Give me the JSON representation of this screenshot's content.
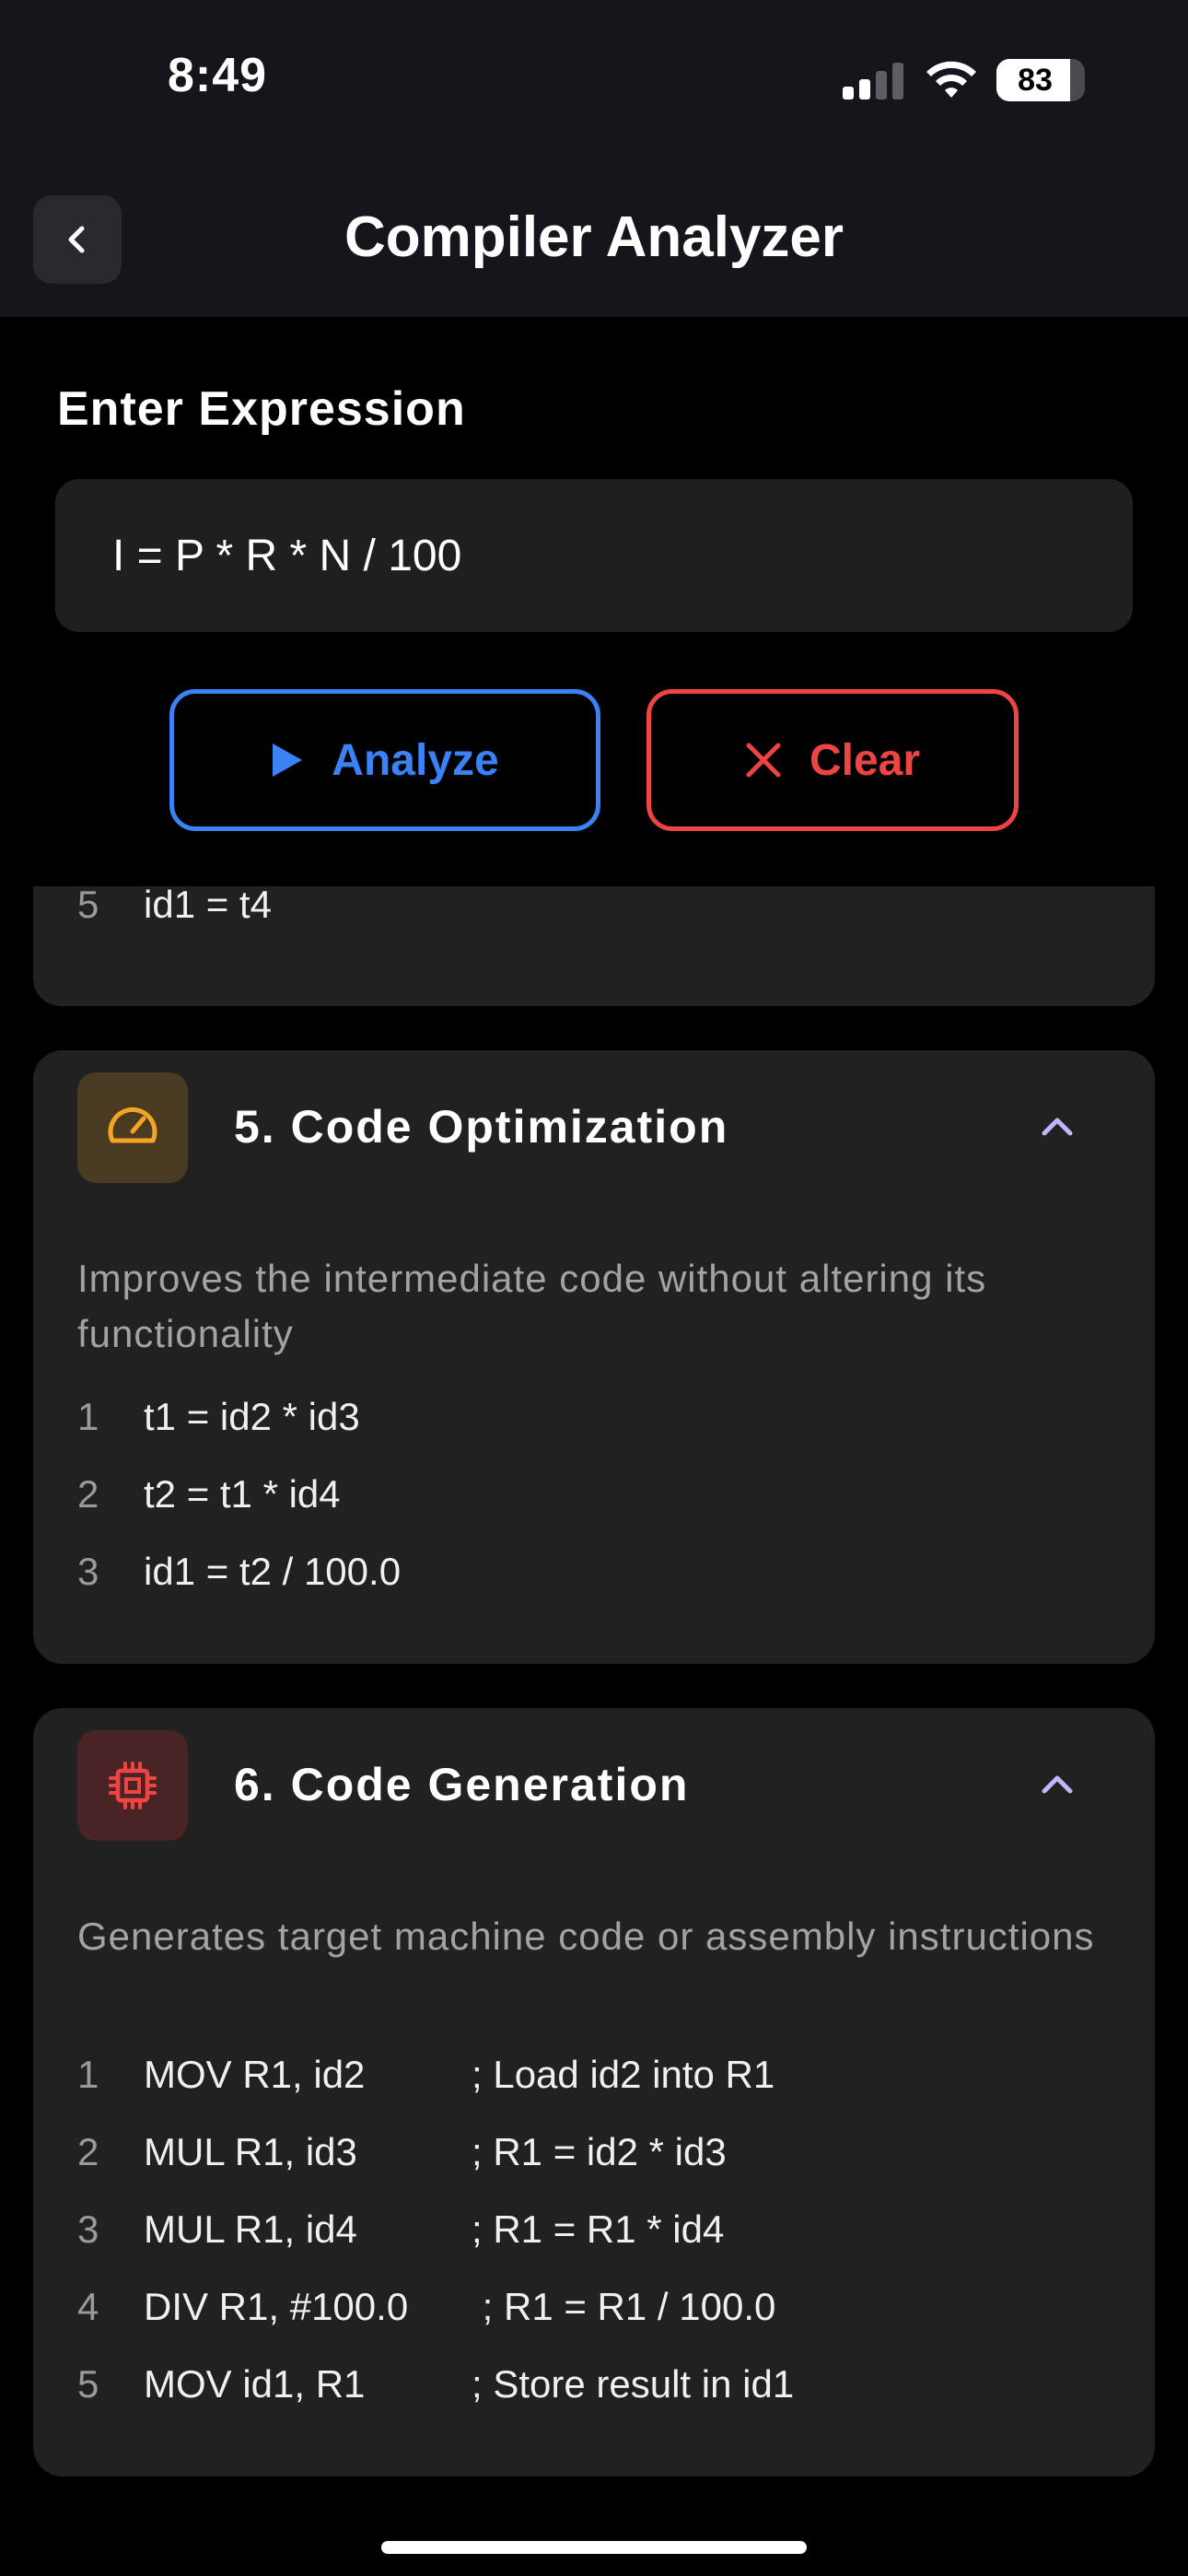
{
  "status_bar": {
    "time": "8:49",
    "battery_percent": "83",
    "battery_level": 0.83
  },
  "header": {
    "title": "Compiler Analyzer",
    "back_icon": "chevron-left-icon"
  },
  "input_section": {
    "label": "Enter Expression",
    "expression_value": "I = P * R * N / 100",
    "analyze_label": "Analyze",
    "clear_label": "Clear"
  },
  "previous_card": {
    "lines": [
      {
        "num": "5",
        "text": "id1 = t4"
      }
    ]
  },
  "optimization_card": {
    "title": "5. Code Optimization",
    "icon": "speedometer-icon",
    "icon_color": "#f5a524",
    "description": "Improves the intermediate code without altering its functionality",
    "lines": [
      {
        "num": "1",
        "text": "t1 = id2 * id3"
      },
      {
        "num": "2",
        "text": "t2 = t1 * id4"
      },
      {
        "num": "3",
        "text": "id1 = t2 / 100.0"
      }
    ]
  },
  "generation_card": {
    "title": "6. Code Generation",
    "icon": "cpu-chip-icon",
    "icon_color": "#ef4444",
    "description": "Generates target machine code or assembly instructions",
    "lines": [
      {
        "num": "1",
        "instr": "MOV R1, id2",
        "comment": "; Load id2 into R1"
      },
      {
        "num": "2",
        "instr": "MUL R1, id3",
        "comment": "; R1 = id2 * id3"
      },
      {
        "num": "3",
        "instr": "MUL R1, id4",
        "comment": "; R1 = R1 * id4"
      },
      {
        "num": "4",
        "instr": "DIV R1, #100.0",
        "comment": " ; R1 = R1 / 100.0"
      },
      {
        "num": "5",
        "instr": "MOV id1, R1",
        "comment": "; Store result in id1"
      }
    ]
  },
  "colors": {
    "accent_blue": "#3b82f6",
    "danger_red": "#ef4444",
    "chevron_purple": "#c4b5fd"
  }
}
